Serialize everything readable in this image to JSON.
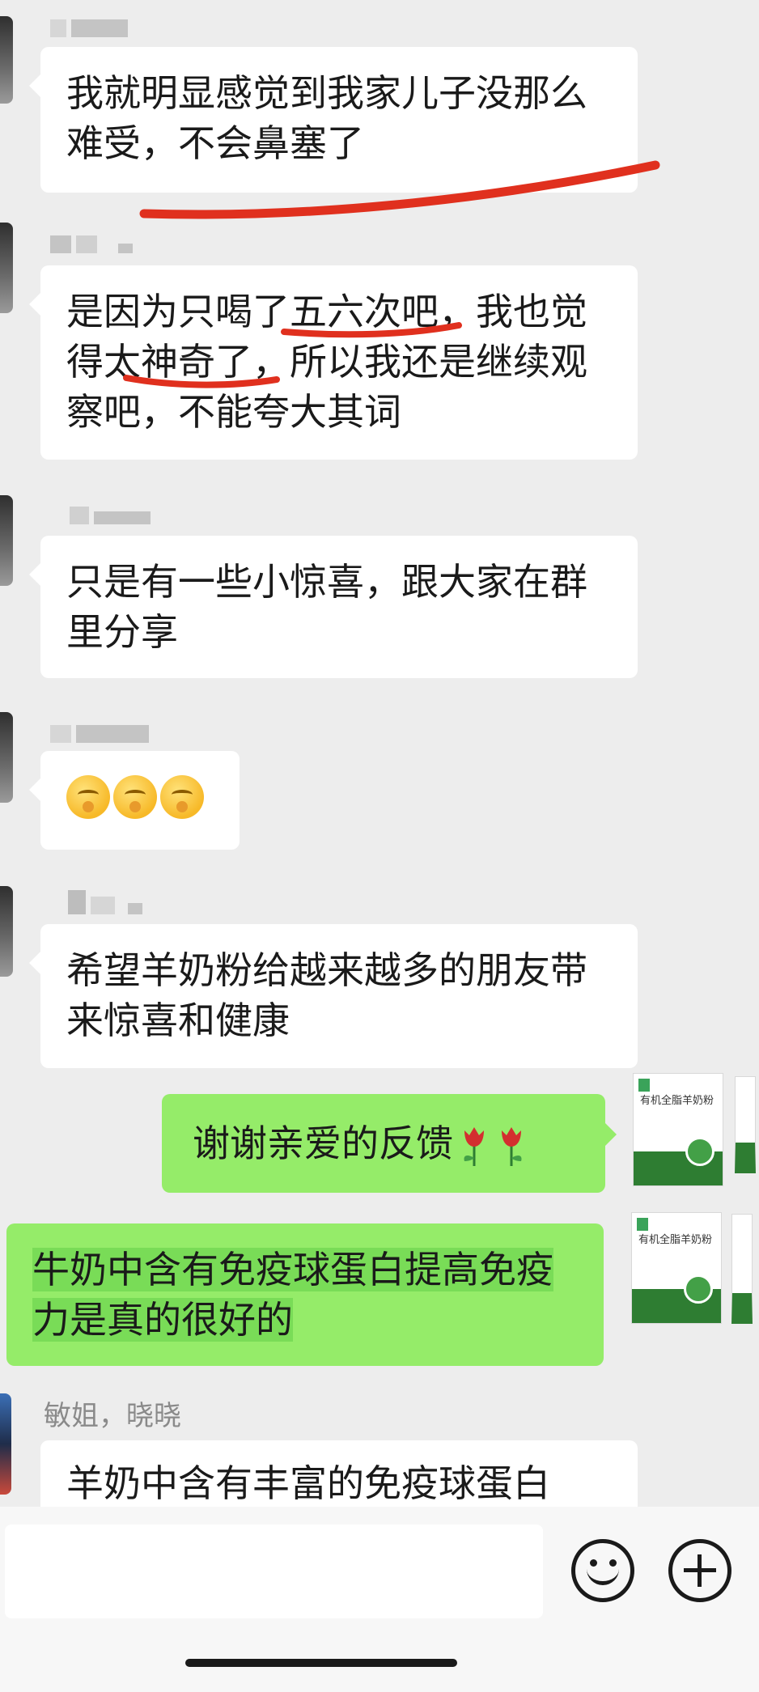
{
  "messages": [
    {
      "text": "我就明显感觉到我家儿子没那么难受，不会鼻塞了"
    },
    {
      "text": "是因为只喝了五六次吧，我也觉得太神奇了，所以我还是继续观察吧，不能夸大其词"
    },
    {
      "text": "只是有一些小惊喜，跟大家在群里分享"
    },
    {
      "emoji_icons": [
        "hand-over-mouth-emoji-icon",
        "hand-over-mouth-emoji-icon",
        "hand-over-mouth-emoji-icon"
      ]
    },
    {
      "text": "希望羊奶粉给越来越多的朋友带来惊喜和健康"
    },
    {
      "text": "谢谢亲爱的反馈",
      "emoji_icons": [
        "rose-icon",
        "rose-icon"
      ]
    },
    {
      "text": "牛奶中含有免疫球蛋白提高免疫力是真的很好的"
    },
    {
      "sender": "敏姐，晓晓",
      "text": "羊奶中含有丰富的免疫球蛋白"
    }
  ],
  "product": {
    "name": "有机全脂羊奶粉"
  },
  "input_bar": {
    "emoji_button_icon": "smiley-icon",
    "more_button_icon": "plus-circle-icon"
  },
  "colors": {
    "background": "#ededed",
    "bubble_white": "#ffffff",
    "bubble_green": "#95ec69",
    "underline_red": "#e0301e"
  }
}
